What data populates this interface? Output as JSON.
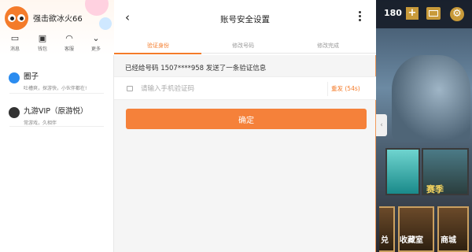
{
  "sidebar": {
    "username": "强击欲冰火66",
    "quick_actions": [
      {
        "label": "消息",
        "icon": "message-icon"
      },
      {
        "label": "钱包",
        "icon": "wallet-icon"
      },
      {
        "label": "客服",
        "icon": "headset-icon"
      },
      {
        "label": "更多",
        "icon": "more-icon"
      }
    ],
    "items": [
      {
        "title": "圈子",
        "subtitle": "吐槽爽，探游快，小伙伴都在!",
        "icon": "circle-icon"
      },
      {
        "title": "九游VIP（原游悦）",
        "subtitle": "常游戏，久相伴",
        "icon": "vip-icon"
      }
    ]
  },
  "panel": {
    "title": "账号安全设置",
    "steps": [
      "验证身份",
      "修改号码",
      "修改完成"
    ],
    "active_step": 0,
    "sent_message": "已经给号码 1507****958 发送了一条验证信息",
    "code_placeholder": "请输入手机验证码",
    "resend_label": "重发 (54s)",
    "confirm_label": "确定"
  },
  "game": {
    "coins": "180",
    "plus_label": "+",
    "season_label": "赛季",
    "bottom_labels": [
      "兑",
      "收藏室",
      "商城"
    ]
  },
  "colors": {
    "accent": "#f47b2a",
    "button": "#f5813a"
  }
}
